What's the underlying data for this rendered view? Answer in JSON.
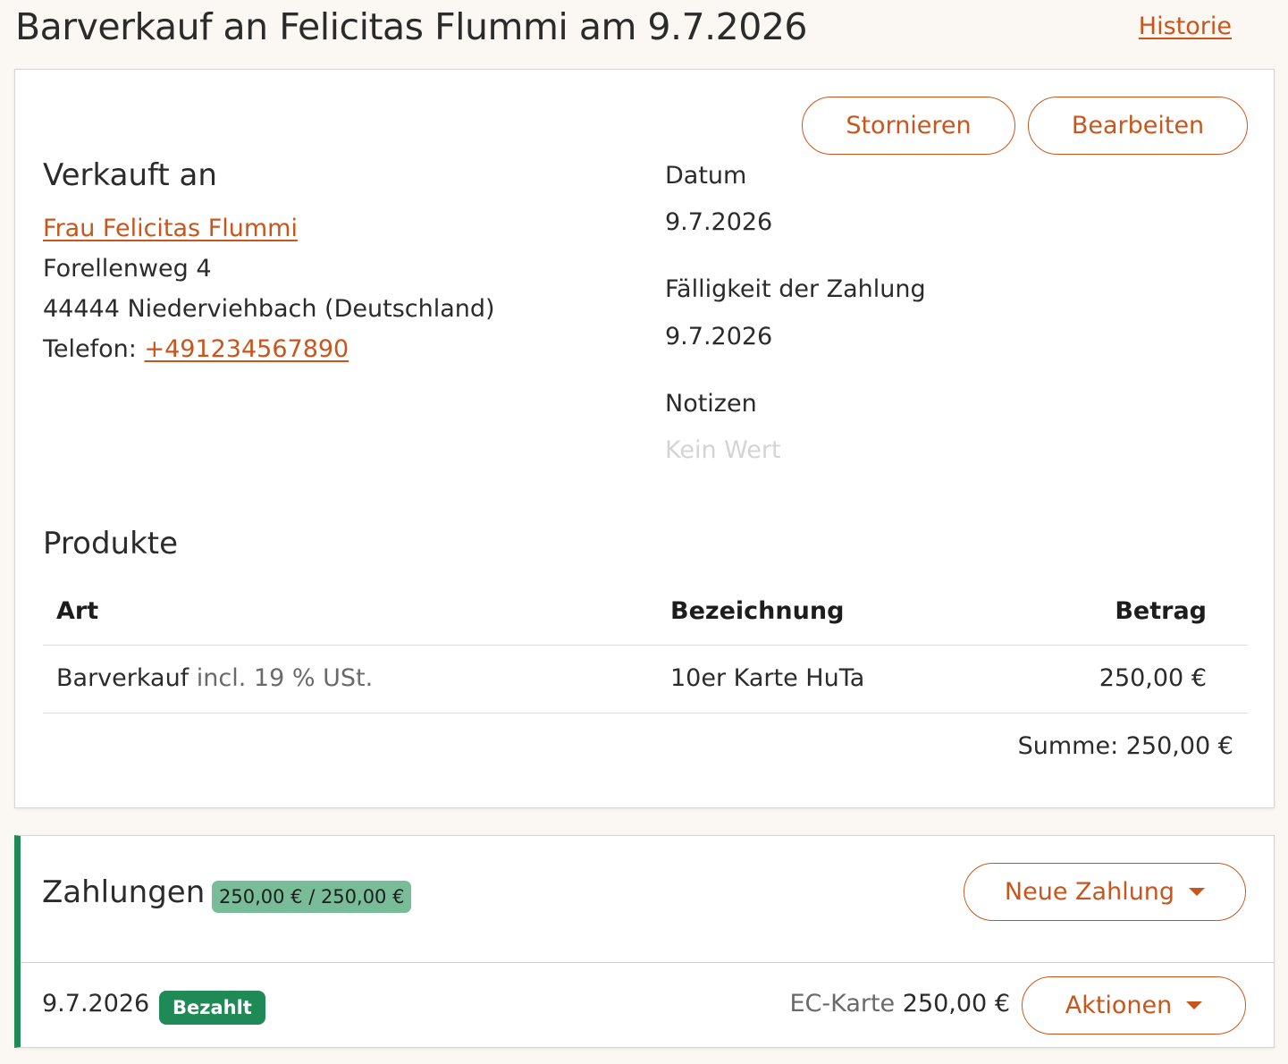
{
  "header": {
    "title": "Barverkauf an Felicitas Flummi am 9.7.2026",
    "history_link": "Historie"
  },
  "actions": {
    "cancel": "Stornieren",
    "edit": "Bearbeiten"
  },
  "buyer": {
    "heading": "Verkauft an",
    "name": "Frau Felicitas Flummi",
    "street": "Forellenweg 4",
    "city": "44444 Niederviehbach (Deutschland)",
    "phone_label": "Telefon:",
    "phone": "+491234567890"
  },
  "details": {
    "date_label": "Datum",
    "date_value": "9.7.2026",
    "due_label": "Fälligkeit der Zahlung",
    "due_value": "9.7.2026",
    "notes_label": "Notizen",
    "notes_value": "Kein Wert"
  },
  "products": {
    "heading": "Produkte",
    "columns": [
      "Art",
      "Bezeichnung",
      "Betrag"
    ],
    "rows": [
      {
        "type": "Barverkauf",
        "tax_note": "incl. 19 % USt.",
        "description": "10er Karte HuTa",
        "amount": "250,00 €"
      }
    ],
    "total": "Summe: 250,00 €"
  },
  "payments": {
    "heading": "Zahlungen",
    "summary_badge": "250,00 € / 250,00 €",
    "new_payment": "Neue Zahlung",
    "items": [
      {
        "date": "9.7.2026",
        "status": "Bezahlt",
        "method": "EC-Karte",
        "amount": "250,00 €",
        "actions": "Aktionen"
      }
    ]
  },
  "colors": {
    "accent": "#c8561c",
    "paid_green": "#1f8a56",
    "badge_green": "#79bd98"
  }
}
